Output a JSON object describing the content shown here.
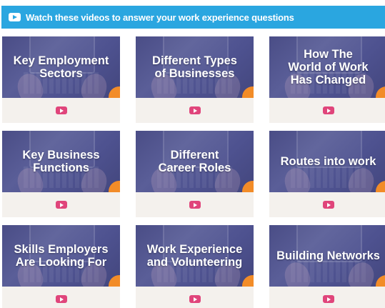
{
  "banner": {
    "text": "Watch these videos to answer your work experience questions",
    "icon": "youtube-play-icon",
    "color": "#2aa6e0"
  },
  "videos": [
    {
      "title": "Key Employment\nSectors"
    },
    {
      "title": "Different Types\nof Businesses"
    },
    {
      "title": "How The\nWorld of Work\nHas Changed"
    },
    {
      "title": "Key Business\nFunctions"
    },
    {
      "title": "Different\nCareer Roles"
    },
    {
      "title": "Routes into work"
    },
    {
      "title": "Skills Employers\nAre Looking For"
    },
    {
      "title": "Work Experience\nand Volunteering"
    },
    {
      "title": "Building Networks"
    }
  ],
  "colors": {
    "thumbnail": "#4e5290",
    "play_button": "#e0457b",
    "accent_corner": "#f28c28",
    "play_bar": "#f4f1ed"
  }
}
